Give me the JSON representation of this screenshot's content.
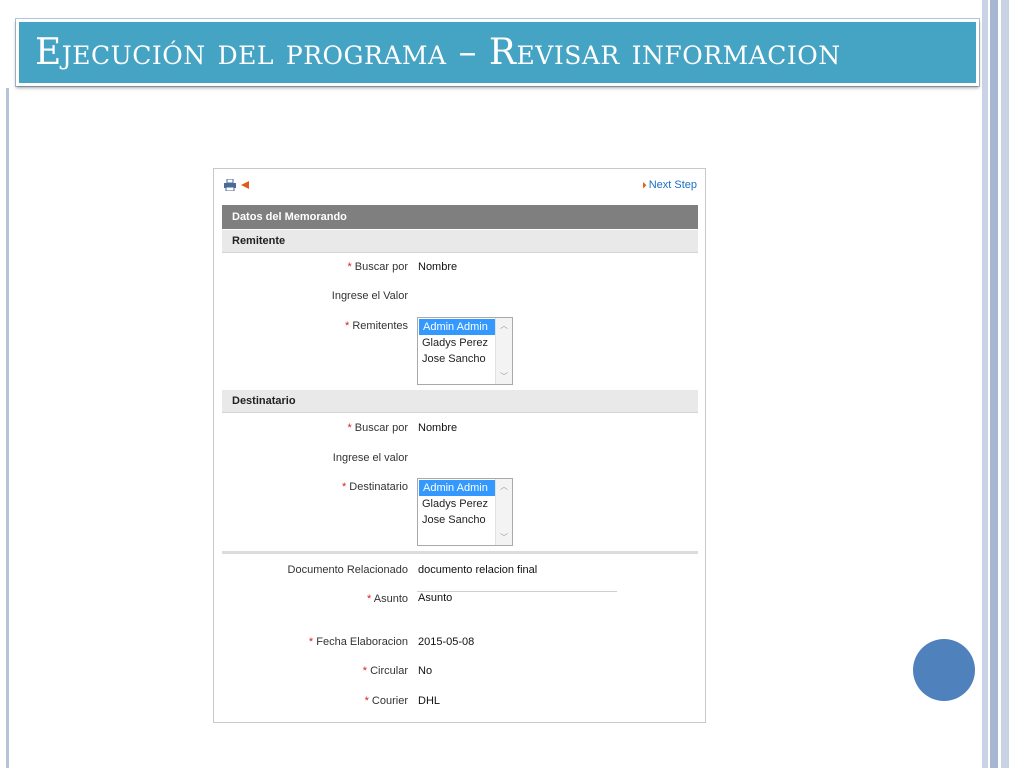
{
  "slide": {
    "title": "Ejecución del programa – Revisar informacion",
    "colors": {
      "title_bar": "#45a3c4",
      "circle": "#4f81bd",
      "section_header": "#7f7f7f",
      "link": "#1c6fc2",
      "required": "#d92020",
      "selected": "#3399ff"
    }
  },
  "app": {
    "toolbar": {
      "print_icon": "printer-icon",
      "back_icon": "back-arrow-icon",
      "next_step": "Next Step"
    },
    "section_title": "Datos del Memorando",
    "remitente": {
      "header": "Remitente",
      "buscar_label": "Buscar por",
      "buscar_value": "Nombre",
      "ingrese_label": "Ingrese el Valor",
      "list_label": "Remitentes",
      "options": [
        "Admin Admin",
        "Gladys Perez",
        "Jose Sancho"
      ],
      "selected": "Admin Admin"
    },
    "destinatario": {
      "header": "Destinatario",
      "buscar_label": "Buscar por",
      "buscar_value": "Nombre",
      "ingrese_label": "Ingrese el valor",
      "list_label": "Destinatario",
      "options": [
        "Admin Admin",
        "Gladys Perez",
        "Jose Sancho"
      ],
      "selected": "Admin Admin"
    },
    "details": {
      "documento_label": "Documento Relacionado",
      "documento_value": "documento relacion final",
      "asunto_label": "Asunto",
      "asunto_value": "Asunto",
      "fecha_label": "Fecha Elaboracion",
      "fecha_value": "2015-05-08",
      "circular_label": "Circular",
      "circular_value": "No",
      "courier_label": "Courier",
      "courier_value": "DHL"
    },
    "required_mark": "*"
  }
}
